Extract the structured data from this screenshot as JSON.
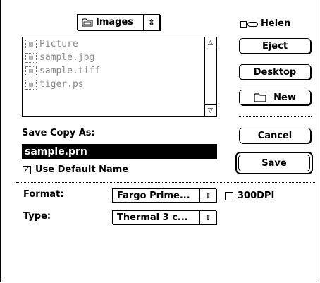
{
  "folder_popup": {
    "label": "Images",
    "icon": "folder-icon"
  },
  "volume": {
    "label": "Helen",
    "icon": "disk-icon"
  },
  "files": [
    {
      "name": "Picture"
    },
    {
      "name": "sample.jpg"
    },
    {
      "name": "sample.tiff"
    },
    {
      "name": "tiger.ps"
    }
  ],
  "buttons": {
    "eject": "Eject",
    "desktop": "Desktop",
    "new": "New",
    "cancel": "Cancel",
    "save": "Save"
  },
  "save_as": {
    "label": "Save Copy As:",
    "value": "sample.prn"
  },
  "use_default_name": {
    "label": "Use Default Name",
    "checked": true
  },
  "format": {
    "label": "Format:",
    "value": "Fargo Prime..."
  },
  "dpi": {
    "label": "300DPI",
    "checked": false
  },
  "type": {
    "label": "Type:",
    "value": "Thermal 3 c..."
  }
}
